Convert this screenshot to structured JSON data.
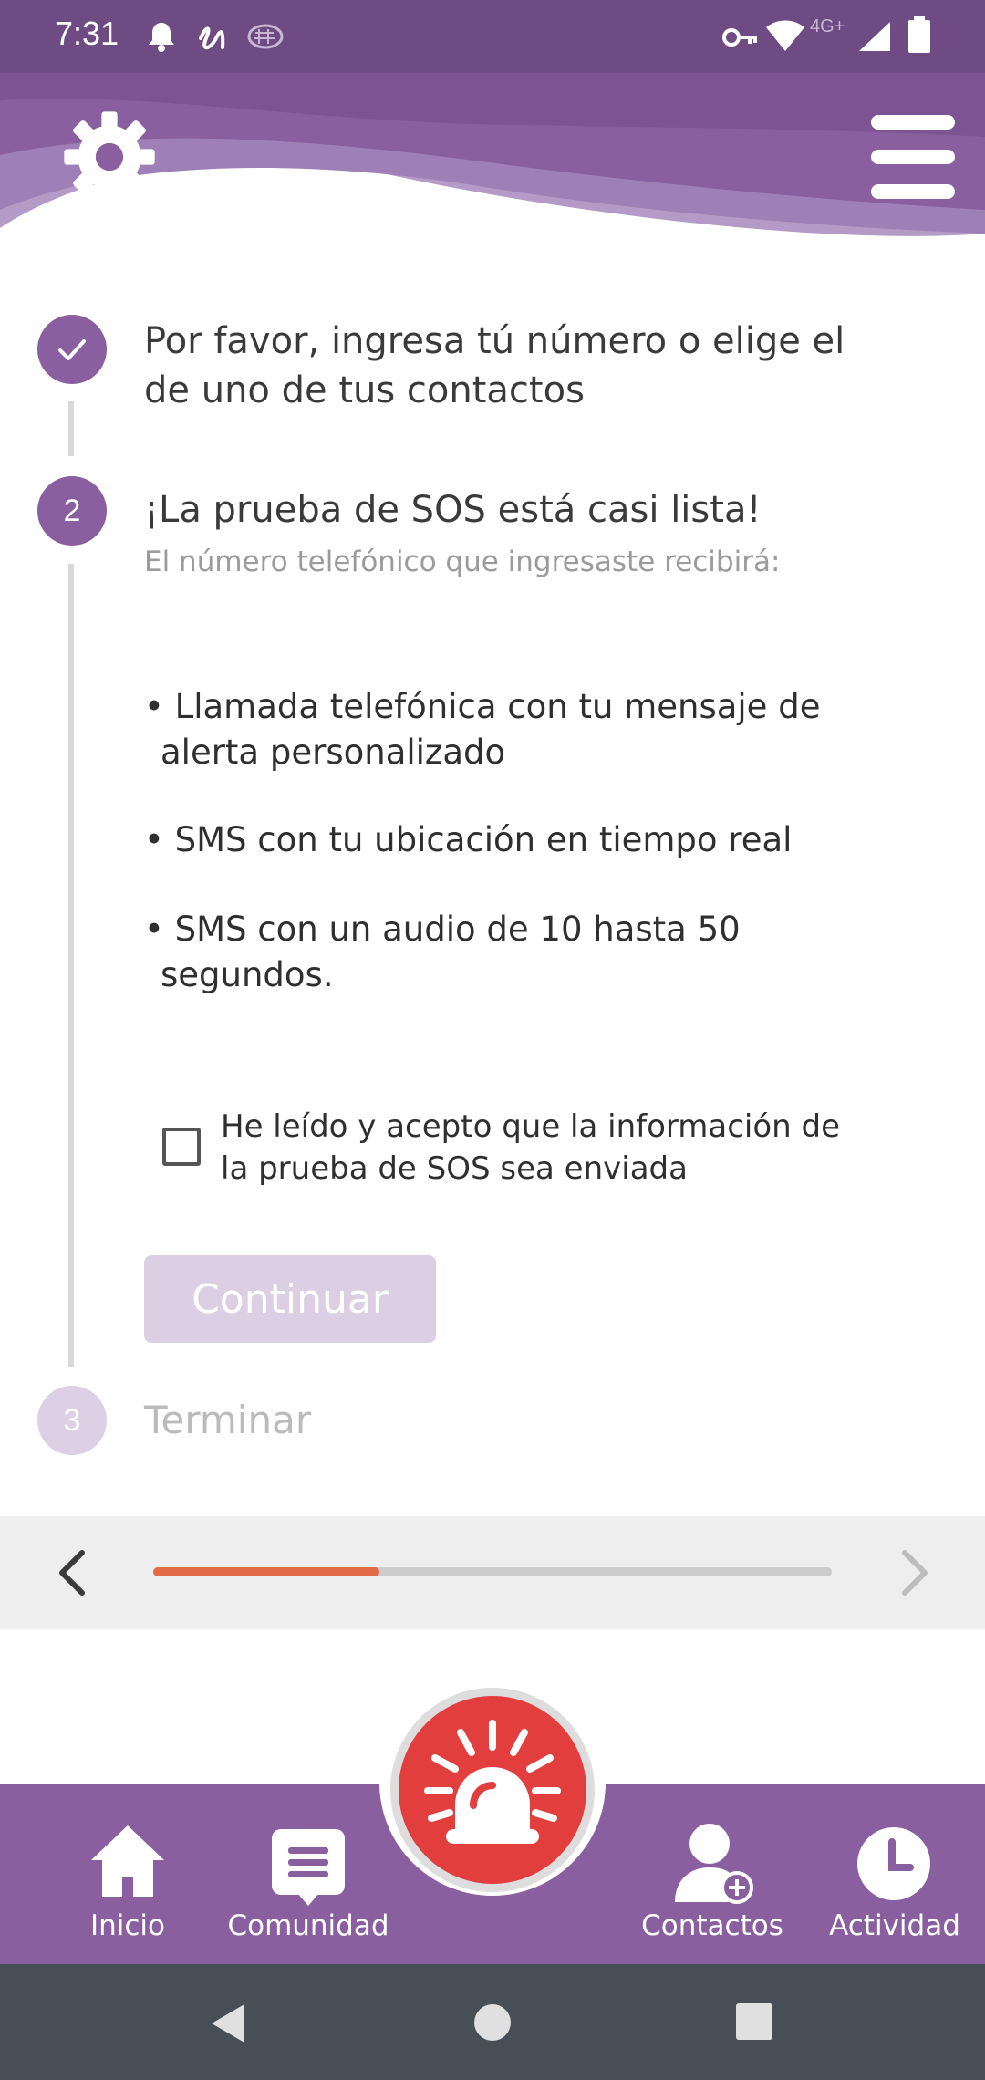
{
  "status_bar": {
    "time": "7:31",
    "network_label": "4G+",
    "icons": [
      "bell-icon",
      "squiggle-icon",
      "brain-icon",
      "key-icon",
      "wifi-icon",
      "signal-icon",
      "battery-icon"
    ]
  },
  "header": {
    "settings_icon": "gear-icon",
    "menu_icon": "hamburger-icon",
    "colors": {
      "primary": "#8a5fa0",
      "dark": "#6e4b83"
    }
  },
  "stepper": {
    "step1": {
      "state": "done",
      "title_line1": "Por favor, ingresa tú número o elige el",
      "title_line2": "de uno de tus contactos"
    },
    "step2": {
      "number": "2",
      "title": "¡La prueba de SOS está casi lista!",
      "subtitle": "El número telefónico que ingresaste recibirá:",
      "bullets": [
        {
          "line1": "Llamada telefónica con tu mensaje de",
          "line2": "alerta personalizado"
        },
        {
          "line1": "SMS con tu ubicación en tiempo real",
          "line2": ""
        },
        {
          "line1": "SMS con un audio de 10 hasta 50",
          "line2": "segundos."
        }
      ],
      "checkbox_line1": "He leído y acepto que la información de",
      "checkbox_line2": "la prueba de SOS sea enviada",
      "checkbox_checked": false,
      "continue_label": "Continuar"
    },
    "step3": {
      "number": "3",
      "title": "Terminar"
    }
  },
  "progress": {
    "fraction": 0.334,
    "color": "#e26a45"
  },
  "bottom_nav": {
    "items": [
      {
        "label": "Inicio",
        "icon": "home-icon"
      },
      {
        "label": "Comunidad",
        "icon": "chat-icon"
      },
      {
        "label": "Contactos",
        "icon": "add-contact-icon"
      },
      {
        "label": "Actividad",
        "icon": "clock-icon"
      }
    ],
    "sos_icon": "siren-icon",
    "sos_color": "#e23e3e"
  },
  "system_nav": {
    "icons": [
      "back-icon",
      "home-circle-icon",
      "recents-icon"
    ]
  }
}
